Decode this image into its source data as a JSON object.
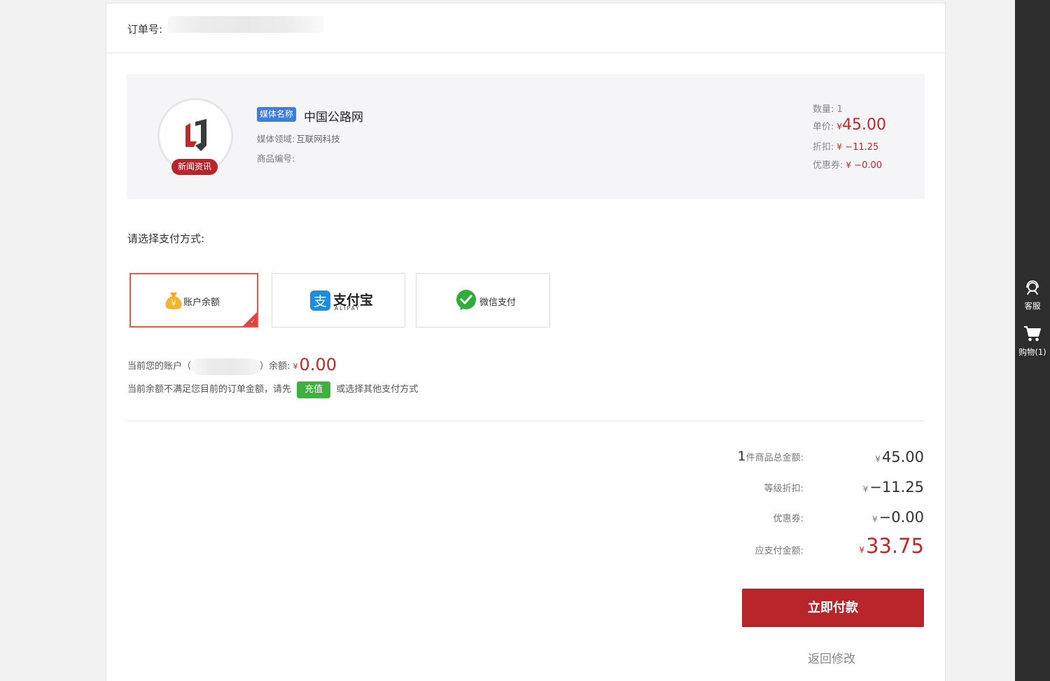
{
  "order": {
    "label": "订单号:"
  },
  "product": {
    "badge": "新闻资讯",
    "tag": "媒体名称",
    "name": "中国公路网",
    "field_label": "媒体领域:",
    "field_value": "互联网科技",
    "code_label": "商品编号:",
    "quantity_label": "数量:",
    "quantity": "1",
    "unit_price_label": "单价:",
    "unit_price": "45.00",
    "discount_label": "折扣:",
    "discount": "−11.25",
    "coupon_label": "优惠券:",
    "coupon": "−0.00",
    "currency": "¥"
  },
  "payment": {
    "title": "请选择支付方式:",
    "methods": [
      {
        "label": "账户余额",
        "selected": true
      },
      {
        "label": "支付宝",
        "sublabel": "ALIPAY",
        "selected": false
      },
      {
        "label": "微信支付",
        "selected": false
      }
    ],
    "balance_prefix": "当前您的账户（",
    "balance_suffix": "）余额:",
    "balance": "0.00",
    "warning_pre": "当前余额不满足您目前的订单金额，请先",
    "recharge": "充值",
    "warning_post": "或选择其他支付方式"
  },
  "summary": {
    "count": "1",
    "total_label": "件商品总金额:",
    "total": "45.00",
    "level_discount_label": "等级折扣:",
    "level_discount": "−11.25",
    "coupon_label": "优惠券:",
    "coupon": "−0.00",
    "payable_label": "应支付金额:",
    "payable": "33.75",
    "currency": "¥"
  },
  "actions": {
    "pay_now": "立即付款",
    "back": "返回修改"
  },
  "sidebar": {
    "service": "客服",
    "cart": "购物(1)"
  },
  "colors": {
    "accent_red": "#b8262c",
    "price_red": "#c0282e",
    "tag_blue": "#3d7ce0",
    "recharge_green": "#3faf3f",
    "sidebar_bg": "#2d2d2d"
  },
  "icons": [
    "money-bag-icon",
    "alipay-logo-icon",
    "wechat-pay-icon",
    "check-icon",
    "customer-service-icon",
    "cart-icon",
    "media-logo"
  ]
}
